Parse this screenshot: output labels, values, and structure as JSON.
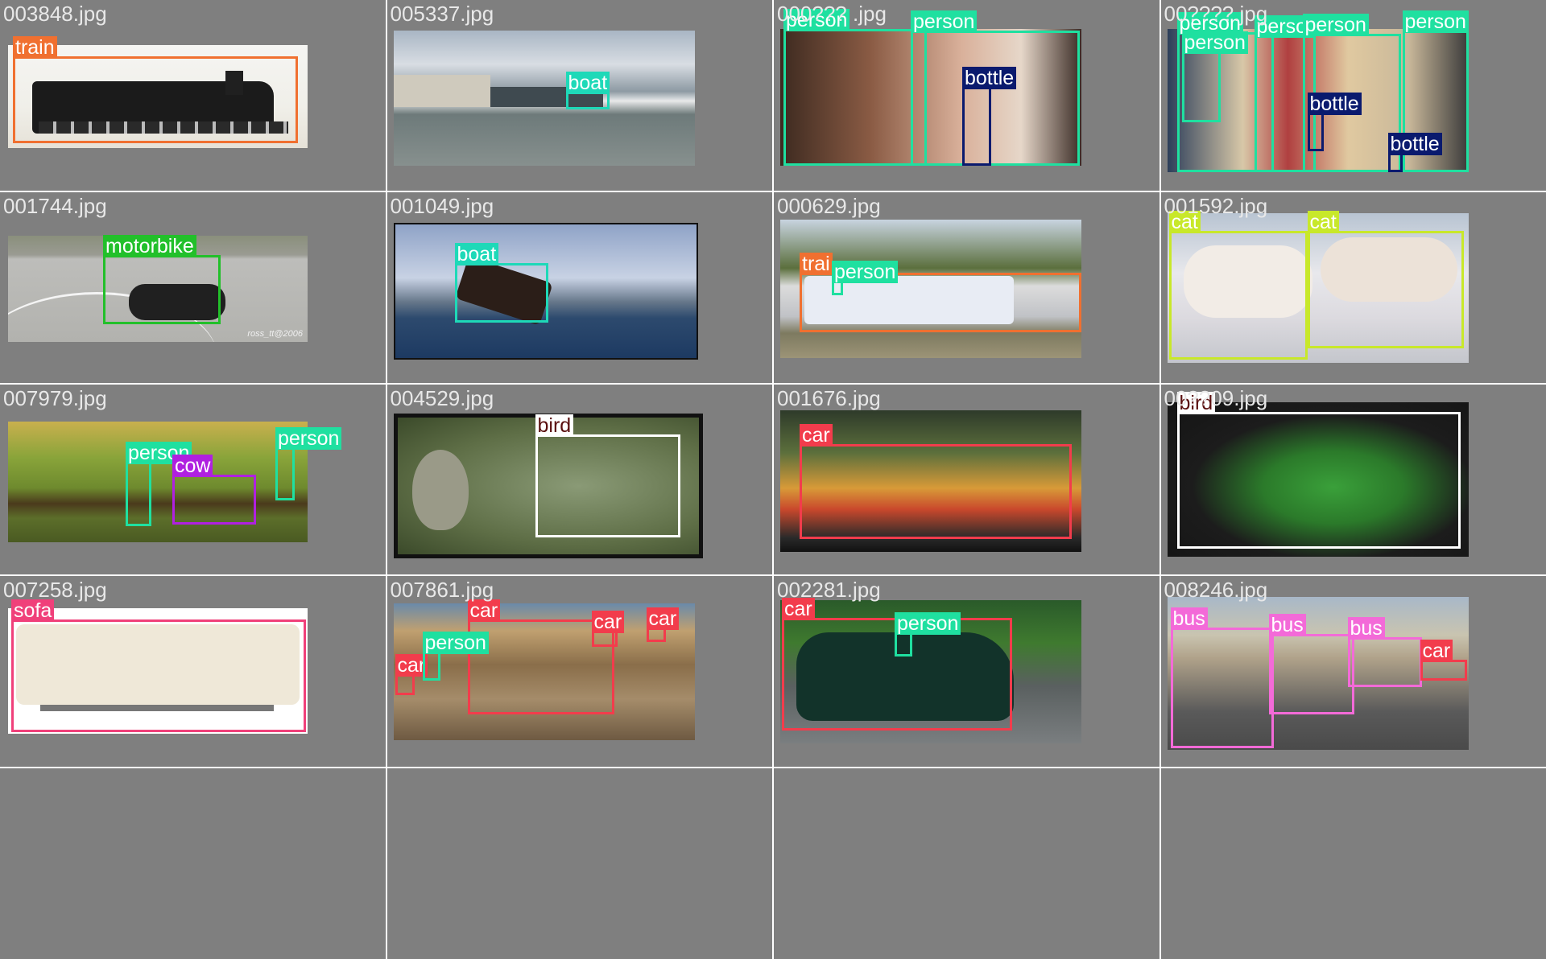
{
  "grid_title": "",
  "colors": {
    "person": "#1fe0a0",
    "bottle": "#0a1a6e",
    "bird": "#5a0f0f",
    "car": "#f23c4c",
    "train": "#f07030",
    "boat": "#1ed9b8",
    "motorbike": "#22c02a",
    "cat": "#c8e82a",
    "cow": "#b020e0",
    "sofa": "#f0407a",
    "bus": "#f36ad8"
  },
  "cells": [
    {
      "filename": "003848.jpg",
      "scene": "locomotive",
      "labels": [
        "train"
      ]
    },
    {
      "filename": "005337.jpg",
      "scene": "harbor",
      "labels": [
        "boat"
      ]
    },
    {
      "filename": "000??? .jpg",
      "scene": "man-and-baby",
      "labels": [
        "person",
        "person",
        "bottle"
      ]
    },
    {
      "filename": "00????.jpg",
      "scene": "party",
      "labels": [
        "person",
        "person",
        "perso",
        "person",
        "person",
        "bottle",
        "bottle"
      ]
    },
    {
      "filename": "001744.jpg",
      "scene": "motorbike-road",
      "labels": [
        "motorbike"
      ]
    },
    {
      "filename": "001049.jpg",
      "scene": "sea-wreck",
      "labels": [
        "boat"
      ]
    },
    {
      "filename": "000629.jpg",
      "scene": "railway",
      "labels": [
        "trai",
        "person"
      ]
    },
    {
      "filename": "001592.jpg",
      "scene": "two-cats",
      "labels": [
        "cat",
        "cat"
      ]
    },
    {
      "filename": "007979.jpg",
      "scene": "field",
      "labels": [
        "person",
        "person",
        "cow"
      ]
    },
    {
      "filename": "004529.jpg",
      "scene": "bird-feeder",
      "labels": [
        "bird"
      ]
    },
    {
      "filename": "001676.jpg",
      "scene": "yellow-truck",
      "labels": [
        "car"
      ]
    },
    {
      "filename": "00??09.jpg",
      "scene": "parrot-wing",
      "labels": [
        "bird"
      ]
    },
    {
      "filename": "007258.jpg",
      "scene": "sofa",
      "labels": [
        "sofa"
      ]
    },
    {
      "filename": "007861.jpg",
      "scene": "offroad",
      "labels": [
        "car",
        "car",
        "car",
        "car",
        "person"
      ]
    },
    {
      "filename": "002281.jpg",
      "scene": "mini-car",
      "labels": [
        "car",
        "person"
      ]
    },
    {
      "filename": "008246.jpg",
      "scene": "buses",
      "labels": [
        "bus",
        "bus",
        "bus",
        "car"
      ]
    }
  ],
  "visible_texts": {
    "c1_watermark": "ross_tt@2006"
  }
}
